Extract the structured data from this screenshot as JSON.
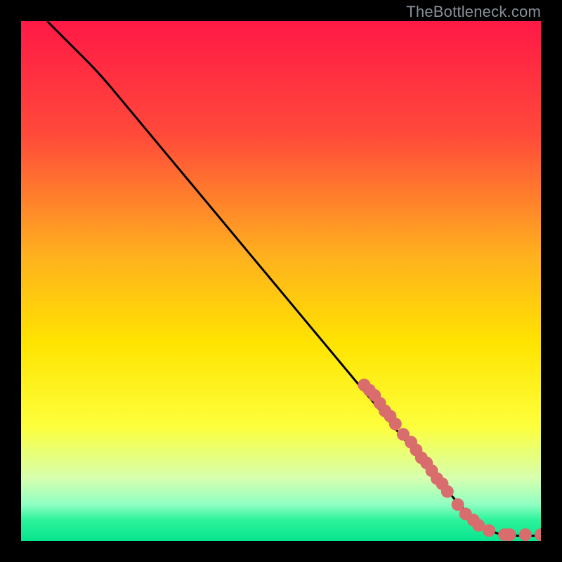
{
  "attribution": "TheBottleneck.com",
  "chart_data": {
    "type": "line",
    "title": "",
    "xlabel": "",
    "ylabel": "",
    "xlim": [
      0,
      100
    ],
    "ylim": [
      0,
      100
    ],
    "gradient_stops": [
      {
        "offset": 0,
        "color": "#ff1946"
      },
      {
        "offset": 0.22,
        "color": "#ff4a3a"
      },
      {
        "offset": 0.45,
        "color": "#ffb01e"
      },
      {
        "offset": 0.62,
        "color": "#ffe400"
      },
      {
        "offset": 0.78,
        "color": "#fdff3c"
      },
      {
        "offset": 0.88,
        "color": "#d6ffb0"
      },
      {
        "offset": 0.93,
        "color": "#8fffc2"
      },
      {
        "offset": 0.96,
        "color": "#2cf39b"
      },
      {
        "offset": 1.0,
        "color": "#06e58e"
      }
    ],
    "curve": [
      {
        "x": 5,
        "y": 100
      },
      {
        "x": 7,
        "y": 98
      },
      {
        "x": 10,
        "y": 95
      },
      {
        "x": 15,
        "y": 90
      },
      {
        "x": 20,
        "y": 84
      },
      {
        "x": 30,
        "y": 72
      },
      {
        "x": 40,
        "y": 60
      },
      {
        "x": 50,
        "y": 48
      },
      {
        "x": 60,
        "y": 36
      },
      {
        "x": 70,
        "y": 24
      },
      {
        "x": 80,
        "y": 12
      },
      {
        "x": 86,
        "y": 5
      },
      {
        "x": 90,
        "y": 2
      },
      {
        "x": 93,
        "y": 1
      },
      {
        "x": 100,
        "y": 1
      }
    ],
    "marker_color": "#d96c6c",
    "markers": [
      {
        "x": 66,
        "y": 30
      },
      {
        "x": 67,
        "y": 29
      },
      {
        "x": 68,
        "y": 28
      },
      {
        "x": 69,
        "y": 26.5
      },
      {
        "x": 70,
        "y": 25
      },
      {
        "x": 71,
        "y": 24
      },
      {
        "x": 72,
        "y": 22.5
      },
      {
        "x": 73.5,
        "y": 20.5
      },
      {
        "x": 75,
        "y": 19
      },
      {
        "x": 76,
        "y": 17.5
      },
      {
        "x": 77,
        "y": 16
      },
      {
        "x": 78,
        "y": 15
      },
      {
        "x": 79,
        "y": 13.5
      },
      {
        "x": 80,
        "y": 12
      },
      {
        "x": 81,
        "y": 11
      },
      {
        "x": 82,
        "y": 9.5
      },
      {
        "x": 84,
        "y": 7
      },
      {
        "x": 85.5,
        "y": 5.2
      },
      {
        "x": 87,
        "y": 4
      },
      {
        "x": 88,
        "y": 3
      },
      {
        "x": 90,
        "y": 2
      },
      {
        "x": 93,
        "y": 1.2
      },
      {
        "x": 94,
        "y": 1.2
      },
      {
        "x": 97,
        "y": 1.2
      },
      {
        "x": 100,
        "y": 1.2
      }
    ]
  }
}
